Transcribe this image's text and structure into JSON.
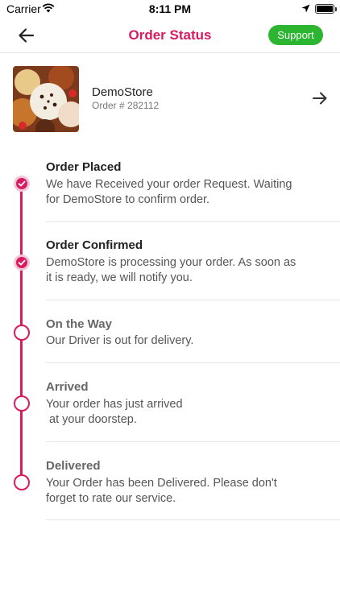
{
  "status_bar": {
    "carrier": "Carrier",
    "time": "8:11 PM"
  },
  "header": {
    "title": "Order Status",
    "support_label": "Support"
  },
  "store": {
    "name": "DemoStore",
    "order_number": "Order # 282112"
  },
  "colors": {
    "accent": "#d81b60",
    "support": "#2bb531"
  },
  "icons": {
    "back": "arrow-left-icon",
    "forward": "arrow-right-icon",
    "done": "check-circle-icon",
    "pending": "empty-circle-icon"
  },
  "steps": [
    {
      "title": "Order Placed",
      "description": "We have Received your order Request. Waiting\nfor DemoStore to confirm order.",
      "completed": true
    },
    {
      "title": "Order Confirmed",
      "description": "DemoStore is processing your order. As soon as\nit is ready, we will notify you.",
      "completed": true
    },
    {
      "title": "On the Way",
      "description": "Our Driver is out for delivery.",
      "completed": false
    },
    {
      "title": "Arrived",
      "description": "Your order has just arrived\n at your doorstep.",
      "completed": false
    },
    {
      "title": "Delivered",
      "description": "Your Order has been Delivered. Please don't\nforget to rate our service.",
      "completed": false
    }
  ]
}
